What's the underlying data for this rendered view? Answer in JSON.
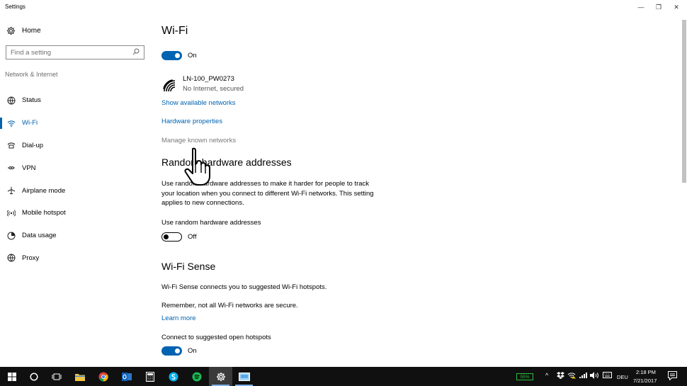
{
  "window": {
    "title": "Settings",
    "minimize_glyph": "—",
    "maximize_glyph": "❐",
    "close_glyph": "✕"
  },
  "sidebar": {
    "home_label": "Home",
    "search_placeholder": "Find a setting",
    "section_label": "Network & Internet",
    "items": [
      {
        "label": "Status",
        "icon": "globe-icon",
        "glyph": "⊕"
      },
      {
        "label": "Wi-Fi",
        "icon": "wifi-icon",
        "glyph": "◠"
      },
      {
        "label": "Dial-up",
        "icon": "dialup-icon",
        "glyph": "☎"
      },
      {
        "label": "VPN",
        "icon": "vpn-icon",
        "glyph": "⚯"
      },
      {
        "label": "Airplane mode",
        "icon": "airplane-icon",
        "glyph": "✈"
      },
      {
        "label": "Mobile hotspot",
        "icon": "hotspot-icon",
        "glyph": "◉"
      },
      {
        "label": "Data usage",
        "icon": "data-usage-icon",
        "glyph": "◔"
      },
      {
        "label": "Proxy",
        "icon": "proxy-icon",
        "glyph": "⊕"
      }
    ]
  },
  "main": {
    "title": "Wi-Fi",
    "wifi_toggle_label": "On",
    "network": {
      "name": "LN-100_PW0273",
      "status": "No Internet, secured"
    },
    "links": {
      "show_networks": "Show available networks",
      "hardware_properties": "Hardware properties",
      "manage_known": "Manage known networks"
    },
    "random_hw": {
      "heading": "Random hardware addresses",
      "description": "Use random hardware addresses to make it harder for people to track your location when you connect to different Wi-Fi networks. This setting applies to new connections.",
      "toggle_caption": "Use random hardware addresses",
      "toggle_label": "Off"
    },
    "wifi_sense": {
      "heading": "Wi-Fi Sense",
      "description": "Wi-Fi Sense connects you to suggested Wi-Fi hotspots.",
      "warning": "Remember, not all Wi-Fi networks are secure.",
      "learn_more": "Learn more",
      "hotspots_caption": "Connect to suggested open hotspots",
      "hotspots_toggle_label": "On"
    }
  },
  "taskbar": {
    "battery": "55%",
    "language": "DEU",
    "time": "2:18 PM",
    "date": "7/21/2017",
    "accent_color": "#0063b1"
  }
}
